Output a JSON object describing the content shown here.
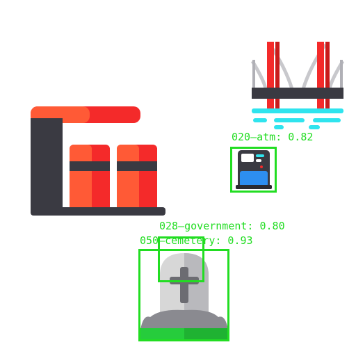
{
  "colors": {
    "detection": "#22dd22",
    "red": "#f42a2a",
    "orange": "#ff5a36",
    "dark": "#3a3a42",
    "cyan": "#2fe4ee",
    "blue": "#2d8ef0",
    "stone": "#d7d7d7",
    "grass": "#26cc3c"
  },
  "icons": {
    "gas_station": "gas-station-icon",
    "bridge": "bridge-icon",
    "atm": "atm-icon",
    "tombstone": "tombstone-icon"
  },
  "detections": [
    {
      "label": "020—atm: 0.82",
      "class": "atm",
      "score": 0.82
    },
    {
      "label": "028—government: 0.80",
      "class": "government",
      "score": 0.8
    },
    {
      "label": "050—cemetery: 0.93",
      "class": "cemetery",
      "score": 0.93
    }
  ]
}
